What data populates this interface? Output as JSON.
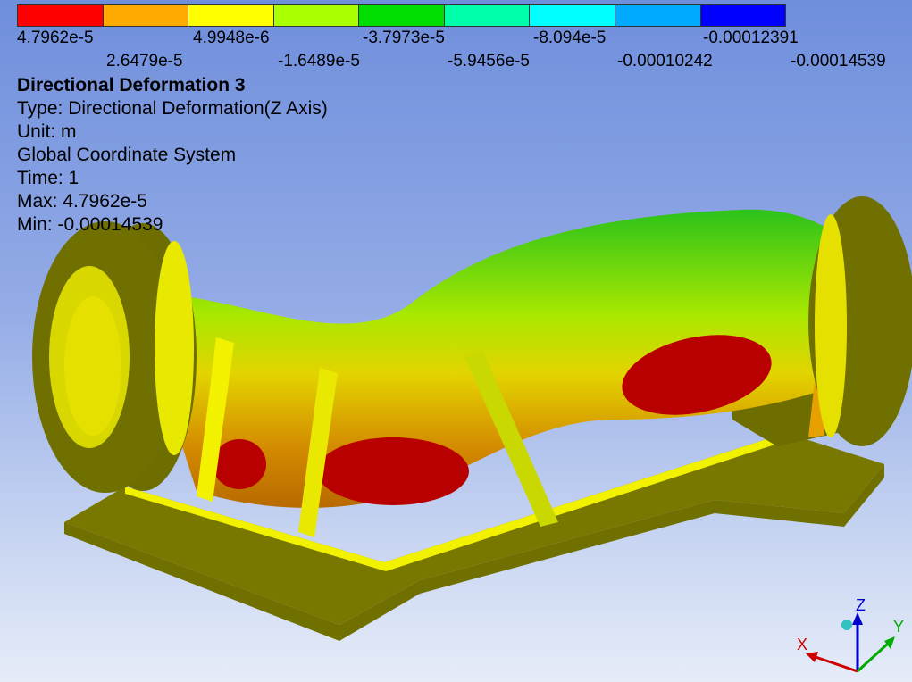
{
  "legend": {
    "colors": [
      "#ff0000",
      "#ffaa00",
      "#ffff00",
      "#aaff00",
      "#00dd00",
      "#00ffaa",
      "#00ffff",
      "#00aaff",
      "#0000ff"
    ],
    "top_values": [
      "4.7962e-5",
      "4.9948e-6",
      "-3.7973e-5",
      "-8.094e-5",
      "-0.00012391"
    ],
    "bottom_values": [
      "2.6479e-5",
      "-1.6489e-5",
      "-5.9456e-5",
      "-0.00010242",
      "-0.00014539"
    ]
  },
  "info": {
    "title": "Directional Deformation 3",
    "type": "Type: Directional Deformation(Z Axis)",
    "unit": "Unit: m",
    "coord": "Global Coordinate System",
    "time": "Time: 1",
    "max": "Max: 4.7962e-5",
    "min": "Min: -0.00014539"
  },
  "triad": {
    "x_label": "X",
    "y_label": "Y",
    "z_label": "Z",
    "x_color": "#cc0000",
    "y_color": "#00aa00",
    "z_color": "#0000cc"
  }
}
